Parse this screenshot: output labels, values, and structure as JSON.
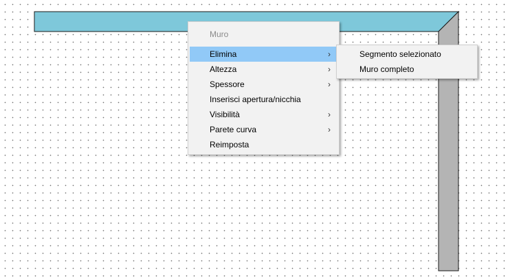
{
  "colors": {
    "wall_fill": "#7ec8da",
    "wall_side": "#b4b4b4",
    "menu_background": "#f2f2f2",
    "highlight": "#91c9f7",
    "disabled_text": "#8a8a8a"
  },
  "context_menu": {
    "title": "Muro",
    "items": [
      {
        "label": "Elimina",
        "has_submenu": true,
        "icon": "chevron-right-icon",
        "highlighted": true
      },
      {
        "label": "Altezza",
        "has_submenu": true,
        "icon": "chevron-right-icon"
      },
      {
        "label": "Spessore",
        "has_submenu": true,
        "icon": "chevron-right-icon"
      },
      {
        "label": "Inserisci apertura/nicchia",
        "has_submenu": false
      },
      {
        "label": "Visibilità",
        "has_submenu": true,
        "icon": "chevron-right-icon"
      },
      {
        "label": "Parete curva",
        "has_submenu": true,
        "icon": "chevron-right-icon"
      },
      {
        "label": "Reimposta",
        "has_submenu": false
      }
    ]
  },
  "submenu": {
    "items": [
      {
        "label": "Segmento selezionato"
      },
      {
        "label": "Muro completo"
      }
    ]
  },
  "submenu_glyph": "›"
}
